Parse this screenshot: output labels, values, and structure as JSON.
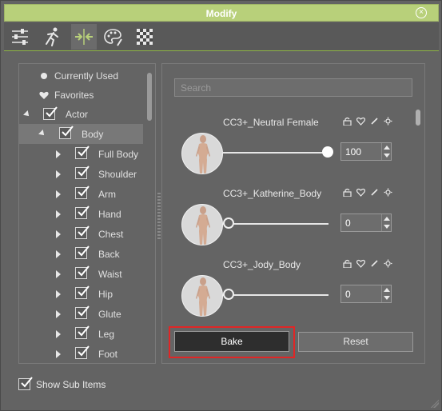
{
  "window": {
    "title": "Modify"
  },
  "tabs": [
    {
      "name": "sliders-icon",
      "active": false
    },
    {
      "name": "motion-pose-icon",
      "active": false
    },
    {
      "name": "morph-icon",
      "active": true
    },
    {
      "name": "palette-icon",
      "active": false
    },
    {
      "name": "checker-texture-icon",
      "active": false
    }
  ],
  "tree": {
    "items": [
      {
        "label": "Currently Used"
      },
      {
        "label": "Favorites"
      },
      {
        "label": "Actor"
      },
      {
        "label": "Body"
      },
      {
        "label": "Full Body"
      },
      {
        "label": "Shoulder"
      },
      {
        "label": "Arm"
      },
      {
        "label": "Hand"
      },
      {
        "label": "Chest"
      },
      {
        "label": "Back"
      },
      {
        "label": "Waist"
      },
      {
        "label": "Hip"
      },
      {
        "label": "Glute"
      },
      {
        "label": "Leg"
      },
      {
        "label": "Foot"
      }
    ]
  },
  "search": {
    "placeholder": "Search"
  },
  "morphs": [
    {
      "name": "CC3+_Neutral Female",
      "value": "100",
      "level": 1.0
    },
    {
      "name": "CC3+_Katherine_Body",
      "value": "0",
      "level": 0.0
    },
    {
      "name": "CC3+_Jody_Body",
      "value": "0",
      "level": 0.0
    }
  ],
  "buttons": {
    "bake": "Bake",
    "reset": "Reset"
  },
  "footer": {
    "show_sub_items": "Show Sub Items"
  },
  "colors": {
    "accent": "#b8d07a",
    "highlight": "#e02626"
  }
}
